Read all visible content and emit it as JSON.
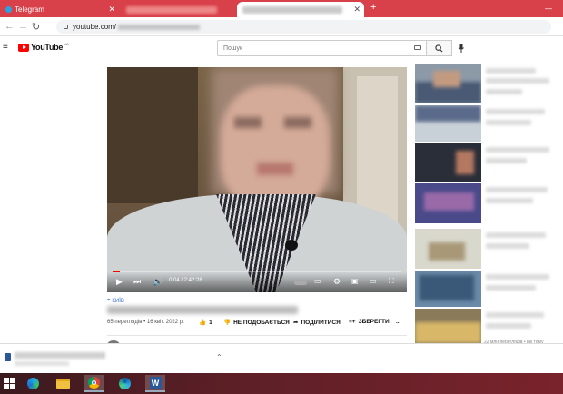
{
  "browser": {
    "tabs": [
      {
        "label": "Telegram",
        "icon": "telegram-icon",
        "active": false
      },
      {
        "label": "",
        "active": false
      },
      {
        "label": "",
        "active": true
      }
    ],
    "new_tab_label": "+",
    "address": "youtube.com/"
  },
  "youtube": {
    "logo_text": "YouTube",
    "logo_suffix": "UA",
    "search_placeholder": "Пошук"
  },
  "player": {
    "current_time": "0:04",
    "duration": "2:42:28",
    "time_display": "0:04 / 2:42:28",
    "progress_fraction": 0.025
  },
  "video": {
    "location": "КИЇВ",
    "views_date": "65 переглядів • 16 квіт. 2022 р.",
    "likes": "1",
    "dislike_label": "НЕ ПОДОБАЄТЬСЯ",
    "share_label": "ПОДІЛИТИСЯ",
    "save_label": "ЗБЕРЕГТИ",
    "more_label": "..."
  },
  "sidebar": {
    "caption": "22 млн переглядів • рік тому"
  },
  "colors": {
    "tabbar": "#d9414a",
    "accent": "#ff0000",
    "link": "#3366cc"
  }
}
